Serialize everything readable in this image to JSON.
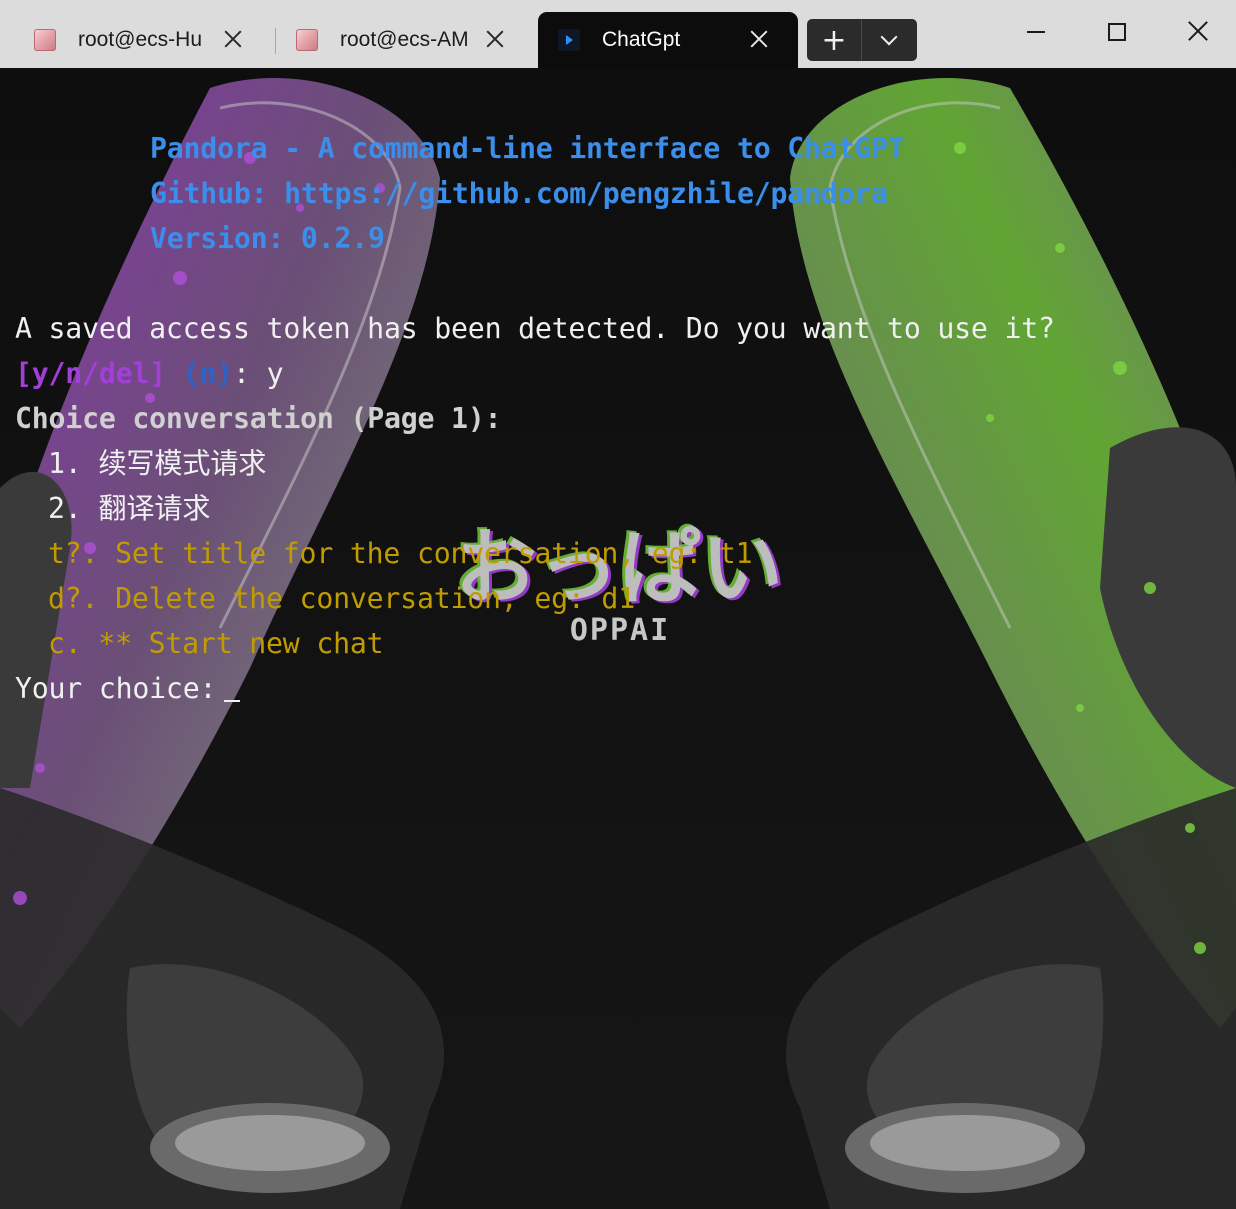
{
  "window": {
    "tabs": [
      {
        "label": "root@ecs-Hu",
        "icon": "anime-avatar-icon",
        "active": false
      },
      {
        "label": "root@ecs-AM",
        "icon": "anime-avatar-icon",
        "active": false
      },
      {
        "label": "ChatGpt",
        "icon": "terminal-icon",
        "active": true
      }
    ],
    "new_tab_symbol": "+",
    "controls": [
      "minimize",
      "maximize",
      "close"
    ]
  },
  "terminal": {
    "banner": {
      "title": "Pandora - A command-line interface to ChatGPT",
      "github": "Github: https://github.com/pengzhile/pandora",
      "version": "Version: 0.2.9"
    },
    "prompt_token": {
      "question": "A saved access token has been detected. Do you want to use it?",
      "options": "[y/n/del]",
      "default": "(n)",
      "separator": ":",
      "answer": "y"
    },
    "conversation_header": {
      "prefix": "Choice conversation",
      "page": "(Page 1):"
    },
    "conversations": [
      {
        "index": "1.",
        "title": "续写模式请求"
      },
      {
        "index": "2.",
        "title": "翻译请求"
      }
    ],
    "commands": [
      "t?. Set title for the conversation, eg: t1",
      "d?. Delete the conversation, eg: d1",
      "c. ** Start new chat"
    ],
    "input_prompt": "Your choice:"
  },
  "background": {
    "logo_text": "おっぱい",
    "logo_subtext": "OPPAI",
    "accent_left": "#9b3fc4",
    "accent_right": "#6fbf3a"
  }
}
